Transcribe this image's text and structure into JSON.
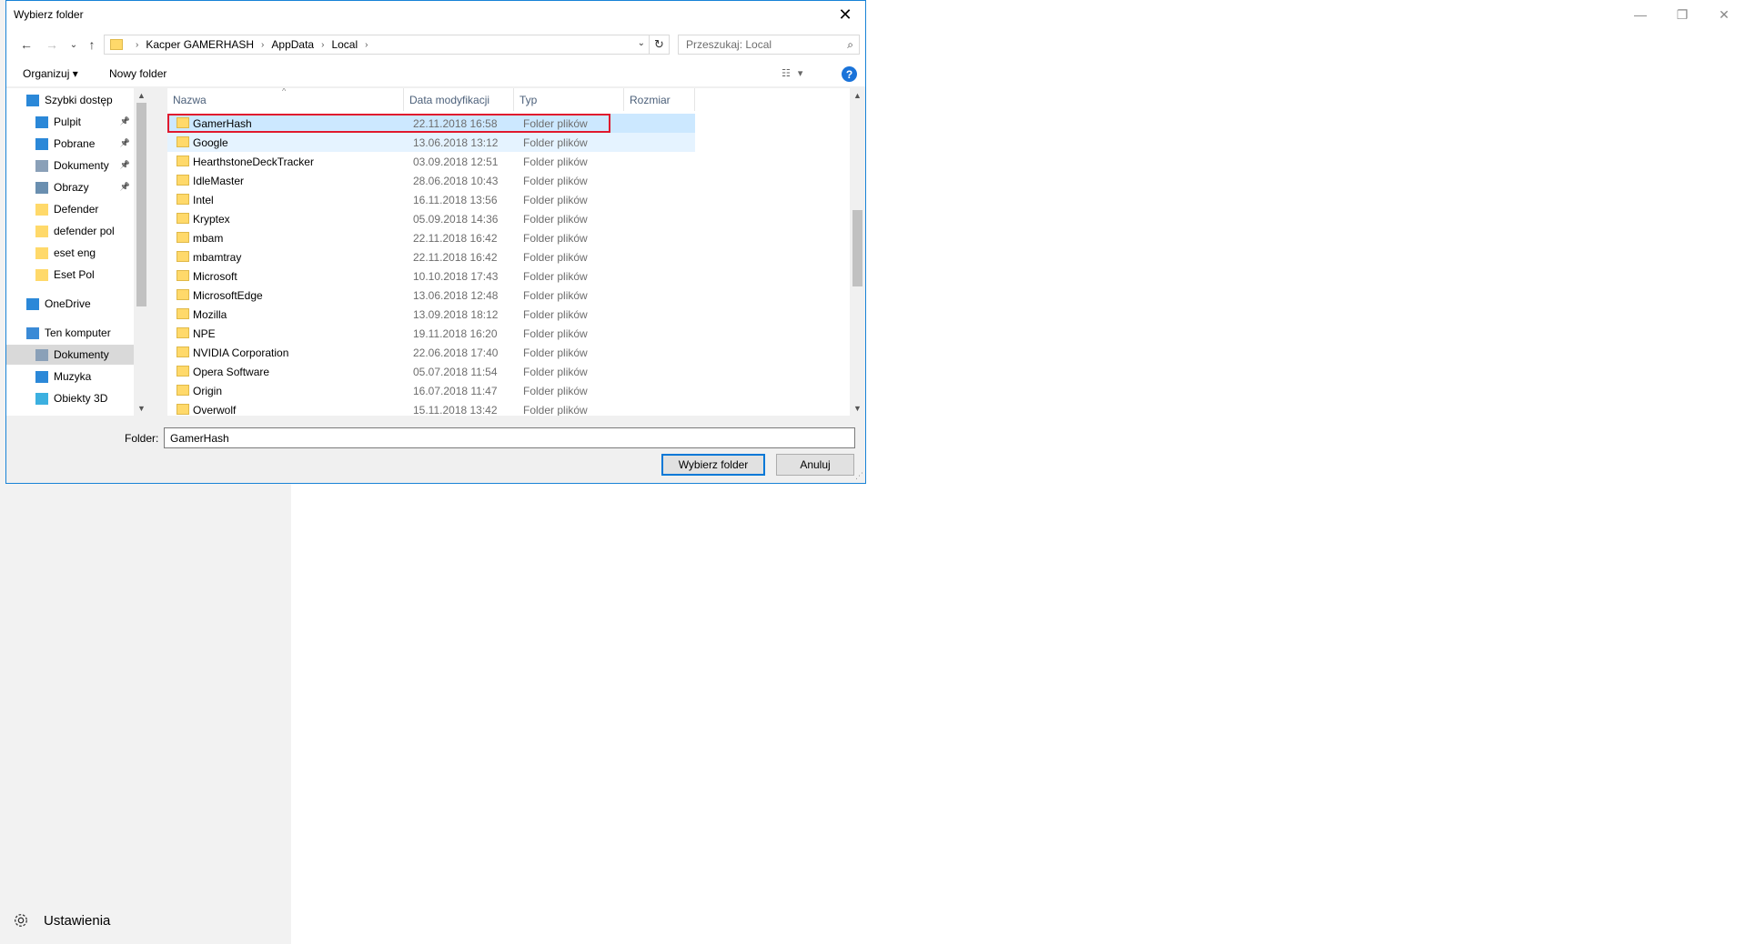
{
  "background": {
    "settings_label": "Ustawienia",
    "window_controls": [
      "—",
      "❐",
      "✕"
    ]
  },
  "dialog": {
    "title": "Wybierz folder",
    "close_glyph": "✕",
    "nav": {
      "back": "←",
      "forward": "→",
      "recent": "⌄",
      "up": "↑"
    },
    "breadcrumb": [
      "Kacper GAMERHASH",
      "AppData",
      "Local"
    ],
    "breadcrumb_sep": "›",
    "address_dropdown": "⌄",
    "refresh_glyph": "↻",
    "search": {
      "placeholder": "Przeszukaj: Local",
      "glyph": "⌕"
    },
    "toolbar": {
      "organize": "Organizuj ▾",
      "new_folder": "Nowy folder",
      "view_glyph": "☷",
      "view_drop": "▾",
      "help": "?"
    },
    "sidebar": [
      {
        "label": "Szybki dostęp",
        "icon": "star-icon",
        "pinned": false,
        "indent": 1
      },
      {
        "label": "Pulpit",
        "icon": "desktop-icon",
        "pinned": true,
        "indent": 2
      },
      {
        "label": "Pobrane",
        "icon": "download-icon",
        "pinned": true,
        "indent": 2
      },
      {
        "label": "Dokumenty",
        "icon": "document-icon",
        "pinned": true,
        "indent": 2
      },
      {
        "label": "Obrazy",
        "icon": "image-icon",
        "pinned": true,
        "indent": 2
      },
      {
        "label": "Defender",
        "icon": "folder-icon",
        "pinned": false,
        "indent": 2
      },
      {
        "label": "defender pol",
        "icon": "folder-icon",
        "pinned": false,
        "indent": 2
      },
      {
        "label": "eset eng",
        "icon": "folder-icon",
        "pinned": false,
        "indent": 2
      },
      {
        "label": "Eset Pol",
        "icon": "folder-icon",
        "pinned": false,
        "indent": 2
      },
      {
        "label": "OneDrive",
        "icon": "cloud-icon",
        "pinned": false,
        "indent": 1
      },
      {
        "label": "Ten komputer",
        "icon": "computer-icon",
        "pinned": false,
        "indent": 1
      },
      {
        "label": "Dokumenty",
        "icon": "document-icon",
        "pinned": false,
        "indent": 2,
        "selected": true
      },
      {
        "label": "Muzyka",
        "icon": "music-icon",
        "pinned": false,
        "indent": 2
      },
      {
        "label": "Obiekty 3D",
        "icon": "cube-icon",
        "pinned": false,
        "indent": 2
      }
    ],
    "columns": [
      "Nazwa",
      "Data modyfikacji",
      "Typ",
      "Rozmiar"
    ],
    "files": [
      {
        "name": "GamerHash",
        "date": "22.11.2018 16:58",
        "type": "Folder plików",
        "state": "selected"
      },
      {
        "name": "Google",
        "date": "13.06.2018 13:12",
        "type": "Folder plików",
        "state": "hover"
      },
      {
        "name": "HearthstoneDeckTracker",
        "date": "03.09.2018 12:51",
        "type": "Folder plików"
      },
      {
        "name": "IdleMaster",
        "date": "28.06.2018 10:43",
        "type": "Folder plików"
      },
      {
        "name": "Intel",
        "date": "16.11.2018 13:56",
        "type": "Folder plików"
      },
      {
        "name": "Kryptex",
        "date": "05.09.2018 14:36",
        "type": "Folder plików"
      },
      {
        "name": "mbam",
        "date": "22.11.2018 16:42",
        "type": "Folder plików"
      },
      {
        "name": "mbamtray",
        "date": "22.11.2018 16:42",
        "type": "Folder plików"
      },
      {
        "name": "Microsoft",
        "date": "10.10.2018 17:43",
        "type": "Folder plików"
      },
      {
        "name": "MicrosoftEdge",
        "date": "13.06.2018 12:48",
        "type": "Folder plików"
      },
      {
        "name": "Mozilla",
        "date": "13.09.2018 18:12",
        "type": "Folder plików"
      },
      {
        "name": "NPE",
        "date": "19.11.2018 16:20",
        "type": "Folder plików"
      },
      {
        "name": "NVIDIA Corporation",
        "date": "22.06.2018 17:40",
        "type": "Folder plików"
      },
      {
        "name": "Opera Software",
        "date": "05.07.2018 11:54",
        "type": "Folder plików"
      },
      {
        "name": "Origin",
        "date": "16.07.2018 11:47",
        "type": "Folder plików"
      },
      {
        "name": "Overwolf",
        "date": "15.11.2018 13:42",
        "type": "Folder plików"
      }
    ],
    "folder_label": "Folder:",
    "folder_value": "GamerHash",
    "select_button": "Wybierz folder",
    "cancel_button": "Anuluj",
    "colors": {
      "accent": "#0078d7",
      "selection": "#cce8ff",
      "highlight": "#e0192e",
      "folder": "#ffd96a"
    }
  }
}
